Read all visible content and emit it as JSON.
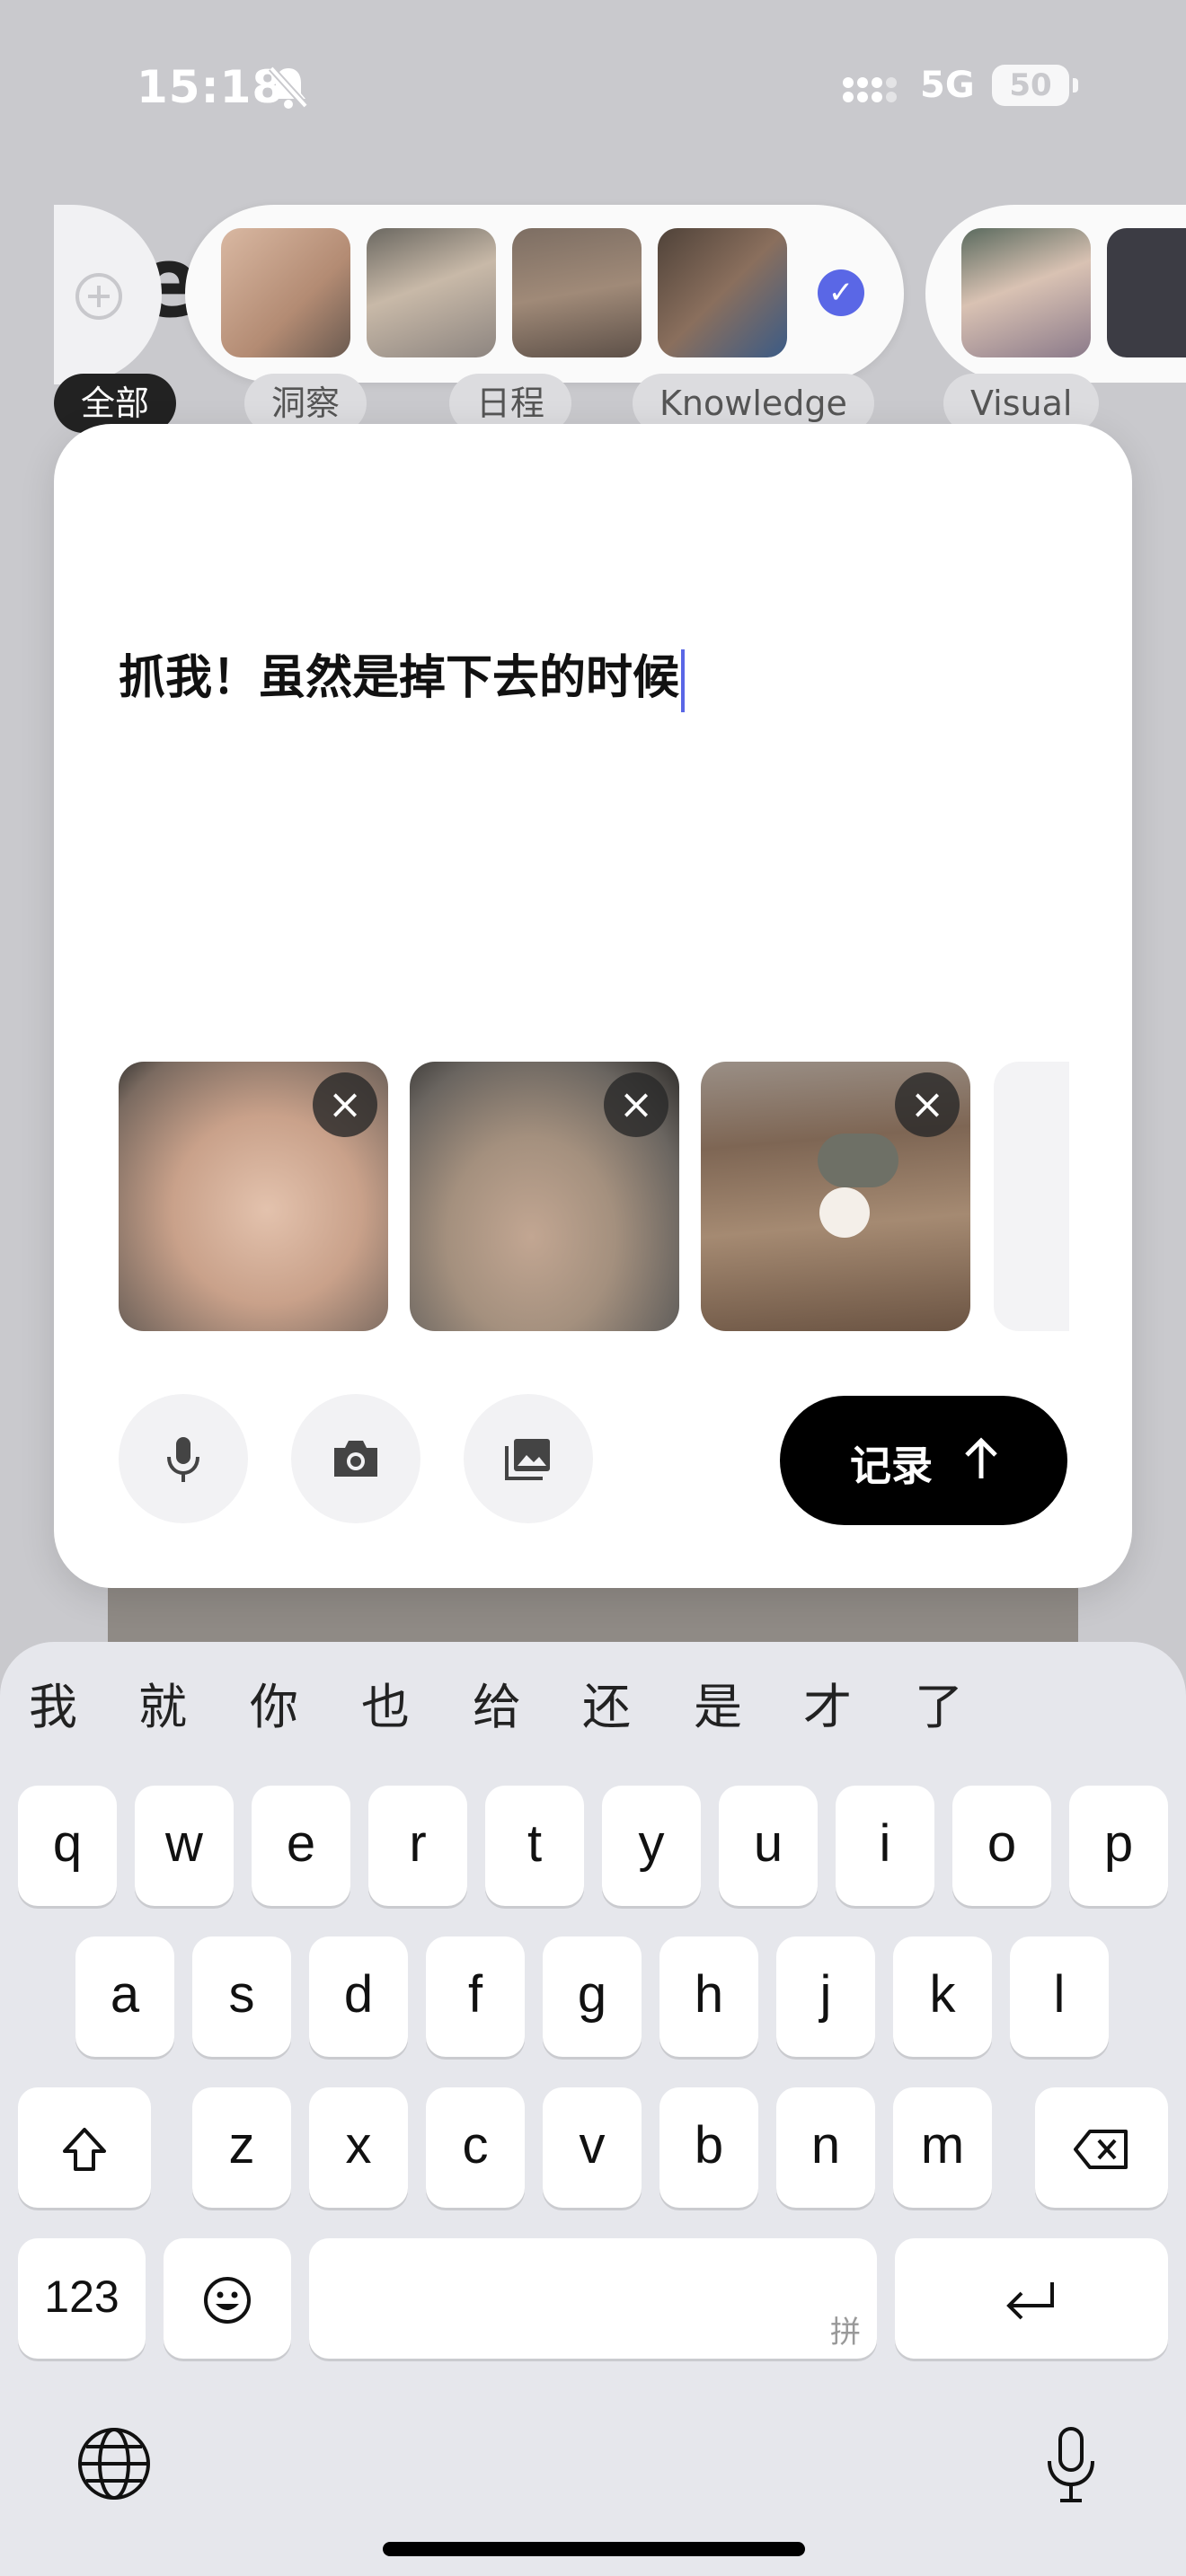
{
  "status": {
    "time": "15:18",
    "network": "5G",
    "battery": "50"
  },
  "background": {
    "title_fragment": "e",
    "categories": [
      "全部",
      "洞察",
      "日程",
      "Knowledge",
      "Visual"
    ]
  },
  "composer": {
    "text": "抓我！虽然是掉下去的时候",
    "record_label": "记录"
  },
  "keyboard": {
    "candidates": [
      "我",
      "就",
      "你",
      "也",
      "给",
      "还",
      "是",
      "才",
      "了"
    ],
    "row1": [
      "q",
      "w",
      "e",
      "r",
      "t",
      "y",
      "u",
      "i",
      "o",
      "p"
    ],
    "row2": [
      "a",
      "s",
      "d",
      "f",
      "g",
      "h",
      "j",
      "k",
      "l"
    ],
    "row3": [
      "z",
      "x",
      "c",
      "v",
      "b",
      "n",
      "m"
    ],
    "numbers_label": "123",
    "space_hint": "拼"
  },
  "icons": {
    "mic": "mic-icon",
    "camera": "camera-icon",
    "gallery": "gallery-icon",
    "shift": "shift-icon",
    "delete": "delete-icon",
    "emoji": "emoji-icon",
    "return": "return-icon",
    "globe": "globe-icon",
    "dictation": "dictation-mic-icon"
  },
  "colors": {
    "accent": "#5a67e6",
    "record_button": "#000000"
  }
}
